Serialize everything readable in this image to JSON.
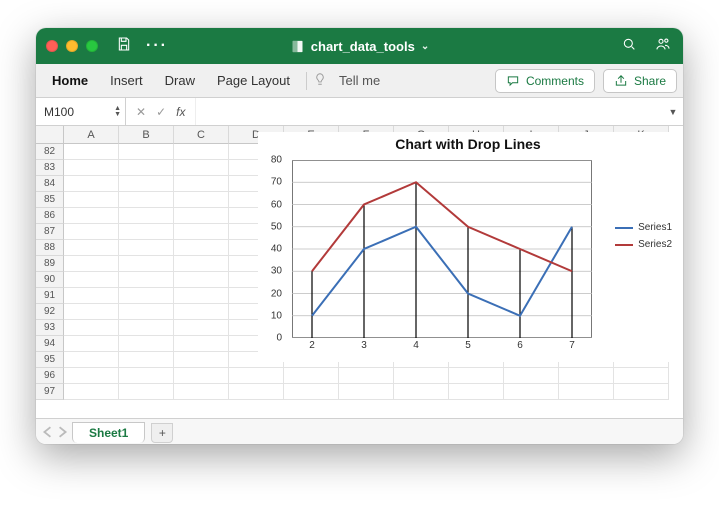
{
  "titlebar": {
    "filename": "chart_data_tools"
  },
  "ribbon": {
    "tabs": {
      "home": "Home",
      "insert": "Insert",
      "draw": "Draw",
      "page_layout": "Page Layout"
    },
    "tellme": "Tell me",
    "comments": "Comments",
    "share": "Share"
  },
  "formula_bar": {
    "namebox": "M100",
    "fx": "fx"
  },
  "grid": {
    "columns": [
      "A",
      "B",
      "C",
      "D",
      "E",
      "F",
      "G",
      "H",
      "I",
      "J",
      "K"
    ],
    "rows": [
      "82",
      "83",
      "84",
      "85",
      "86",
      "87",
      "88",
      "89",
      "90",
      "91",
      "92",
      "93",
      "94",
      "95",
      "96",
      "97"
    ]
  },
  "sheetbar": {
    "sheet1": "Sheet1"
  },
  "chart_data": {
    "type": "line",
    "title": "Chart with Drop Lines",
    "x": [
      2,
      3,
      4,
      5,
      6,
      7
    ],
    "series": [
      {
        "name": "Series1",
        "values": [
          10,
          40,
          50,
          20,
          10,
          50
        ],
        "color": "#3b6fb6"
      },
      {
        "name": "Series2",
        "values": [
          30,
          60,
          70,
          50,
          40,
          30
        ],
        "color": "#b23a3a"
      }
    ],
    "xlabel": "",
    "ylabel": "",
    "ylim": [
      0,
      80
    ],
    "yticks": [
      0,
      10,
      20,
      30,
      40,
      50,
      60,
      70,
      80
    ],
    "drop_lines": true
  }
}
